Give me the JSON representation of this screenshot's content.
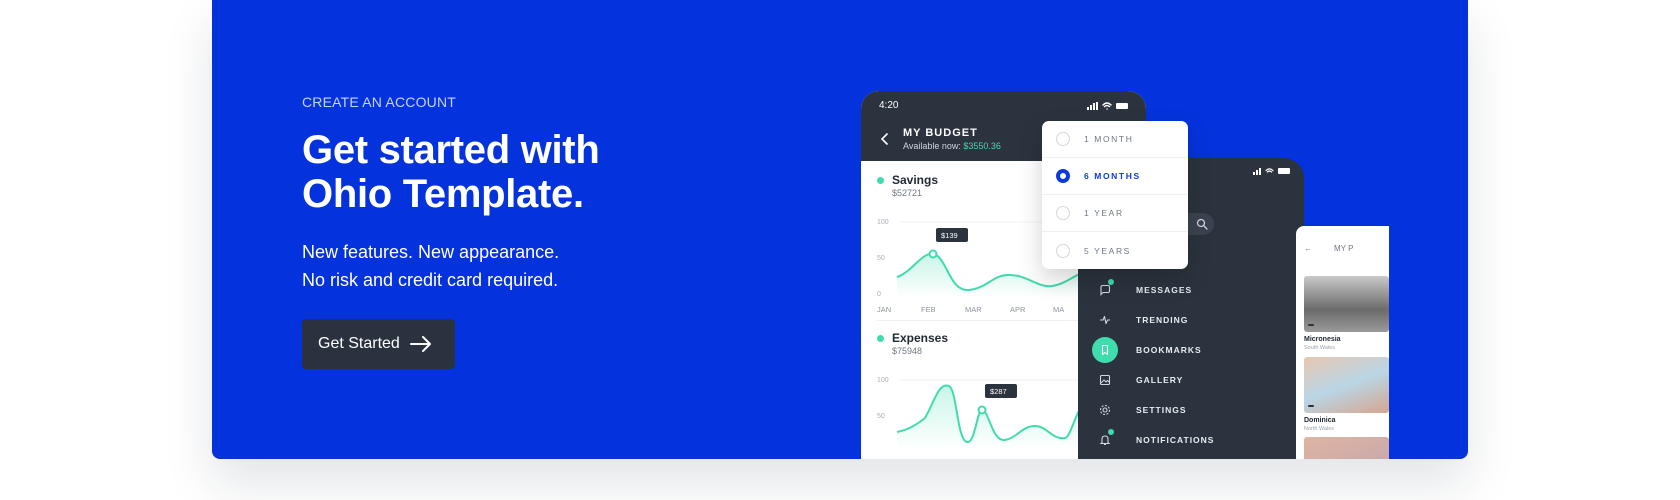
{
  "hero": {
    "eyebrow": "CREATE AN ACCOUNT",
    "headline_line1": "Get started with",
    "headline_line2": "Ohio Template.",
    "sub_line1": "New features. New appearance.",
    "sub_line2": "No risk and credit card required.",
    "cta_label": "Get Started"
  },
  "phone_budget": {
    "time": "4:20",
    "title": "MY BUDGET",
    "available_label": "Available now:",
    "available_value": "$3550.36",
    "savings": {
      "title": "Savings",
      "amount": "$52721",
      "tooltip": "$139",
      "y_ticks": [
        "100",
        "50",
        "0"
      ],
      "x_ticks": [
        "JAN",
        "FEB",
        "MAR",
        "APR",
        "MA"
      ]
    },
    "expenses": {
      "title": "Expenses",
      "amount": "$75948",
      "tooltip": "$287",
      "y_ticks": [
        "100",
        "50"
      ]
    }
  },
  "period_dropdown": {
    "options": [
      {
        "label": "1 MONTH",
        "selected": false
      },
      {
        "label": "6 MONTHS",
        "selected": true
      },
      {
        "label": "1 YEAR",
        "selected": false
      },
      {
        "label": "5 YEARS",
        "selected": false
      }
    ]
  },
  "phone_menu": {
    "items": [
      {
        "label": "MESSAGES",
        "icon": "chat-icon",
        "badge": true
      },
      {
        "label": "TRENDING",
        "icon": "pulse-icon"
      },
      {
        "label": "BOOKMARKS",
        "icon": "bookmark-icon",
        "active": true
      },
      {
        "label": "GALLERY",
        "icon": "image-icon"
      },
      {
        "label": "SETTINGS",
        "icon": "gear-icon"
      },
      {
        "label": "NOTIFICATIONS",
        "icon": "bell-icon",
        "badge": true
      }
    ]
  },
  "card_places": {
    "header": "MY P",
    "places": [
      {
        "name": "Micronesia",
        "region": "South Wales"
      },
      {
        "name": "Dominica",
        "region": "North Wales"
      }
    ]
  },
  "colors": {
    "banner": "#0433dd",
    "dark": "#2b333e",
    "accent": "#3fdcad",
    "selected": "#0b3be0"
  }
}
